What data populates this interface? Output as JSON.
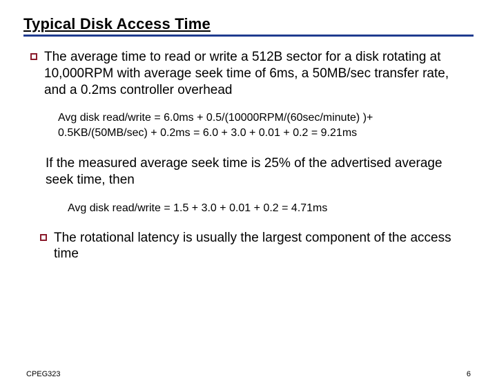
{
  "slide": {
    "title": "Typical Disk Access Time",
    "para1": "The average time to read or write a 512B sector for a disk rotating at 10,000RPM with average seek time of 6ms, a 50MB/sec transfer rate, and a 0.2ms controller overhead",
    "calc1_line1": "Avg disk read/write = 6.0ms + 0.5/(10000RPM/(60sec/minute) )+",
    "calc1_line2": "0.5KB/(50MB/sec) + 0.2ms  =  6.0 + 3.0 + 0.01 + 0.2  =  9.21ms",
    "para2": "If the measured average seek time is 25% of the advertised average seek time, then",
    "calc2": "Avg disk read/write =  1.5 + 3.0 + 0.01 + 0.2  =  4.71ms",
    "para3": "The rotational latency is usually the largest component of the access time"
  },
  "footer": {
    "left": "CPEG323",
    "right": "6"
  }
}
